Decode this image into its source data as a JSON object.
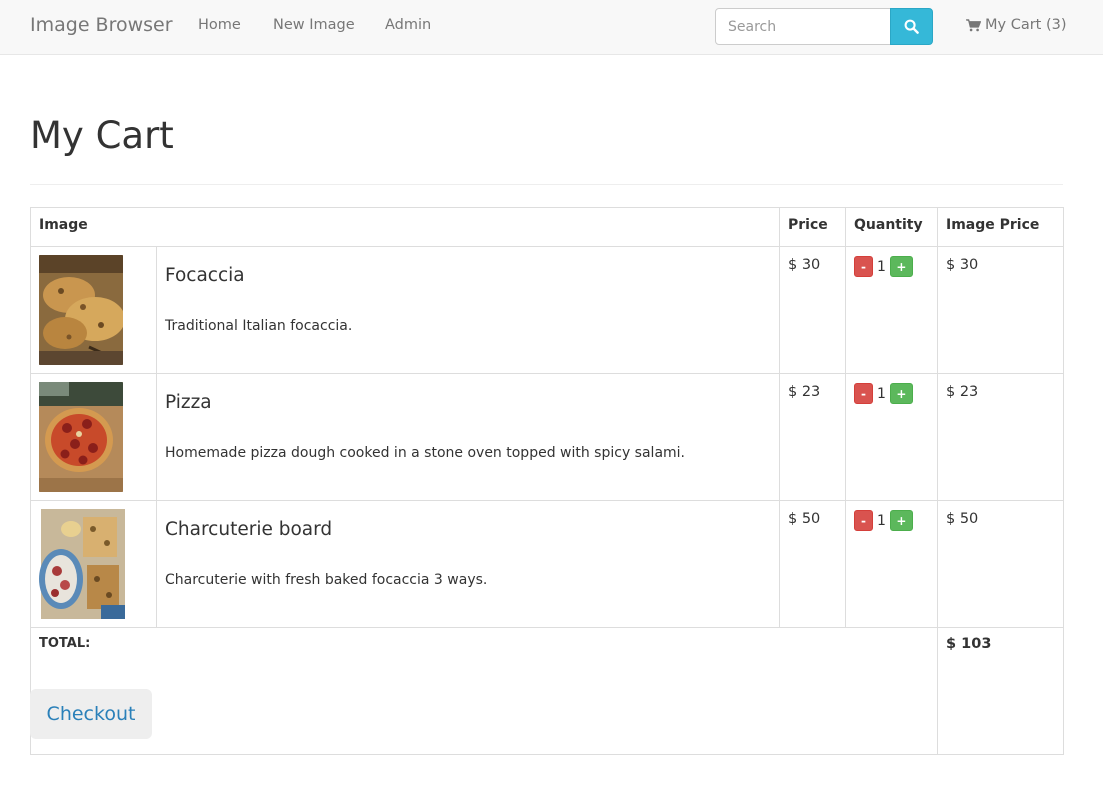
{
  "navbar": {
    "brand": "Image Browser",
    "links": [
      "Home",
      "New Image",
      "Admin"
    ],
    "search_placeholder": "Search",
    "search_icon": "search-icon",
    "cart_icon": "shopping-cart-icon",
    "cart_label": "My Cart (3)"
  },
  "page": {
    "title": "My Cart"
  },
  "table": {
    "headers": [
      "Image",
      "Price",
      "Quantity",
      "Image Price"
    ],
    "rows": [
      {
        "name": "Focaccia",
        "description": "Traditional Italian focaccia.",
        "price": "$ 30",
        "quantity": "1",
        "image_price": "$ 30"
      },
      {
        "name": "Pizza",
        "description": "Homemade pizza dough cooked in a stone oven topped with spicy salami.",
        "price": "$ 23",
        "quantity": "1",
        "image_price": "$ 23"
      },
      {
        "name": "Charcuterie board",
        "description": "Charcuterie with fresh baked focaccia 3 ways.",
        "price": "$ 50",
        "quantity": "1",
        "image_price": "$ 50"
      }
    ],
    "qty_minus": "-",
    "qty_plus": "+",
    "total_label": "TOTAL:",
    "total_value": "$ 103"
  },
  "actions": {
    "checkout_label": "Checkout"
  },
  "colors": {
    "accent": "#35b8d8",
    "minus": "#d9534f",
    "plus": "#5cb85c",
    "link": "#2a80b9"
  }
}
